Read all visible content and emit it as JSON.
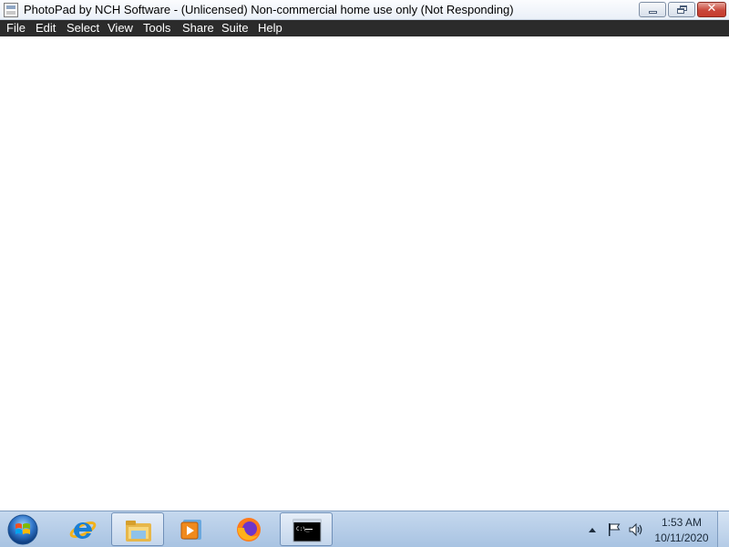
{
  "window": {
    "title": "PhotoPad by NCH Software - (Unlicensed) Non-commercial home use only (Not Responding)",
    "icon": "photopad-app-icon",
    "controls": {
      "minimize": "minimize-icon",
      "maximize": "restore-icon",
      "close": "✕"
    }
  },
  "menu": {
    "items": [
      {
        "label": "File"
      },
      {
        "label": "Edit"
      },
      {
        "label": "Select"
      },
      {
        "label": "View"
      },
      {
        "label": "Tools"
      },
      {
        "label": "Share"
      },
      {
        "label": "Suite"
      },
      {
        "label": "Help"
      }
    ]
  },
  "taskbar": {
    "start": "windows-start-icon",
    "apps": [
      {
        "name": "internet-explorer-icon",
        "active": false
      },
      {
        "name": "file-explorer-icon",
        "active": true
      },
      {
        "name": "media-player-icon",
        "active": false
      },
      {
        "name": "firefox-icon",
        "active": false
      },
      {
        "name": "command-prompt-icon",
        "active": true
      }
    ],
    "tray": {
      "icons": [
        "show-hidden-icons-arrow-icon",
        "action-center-flag-icon",
        "volume-icon"
      ],
      "time": "1:53 AM",
      "date": "10/11/2020"
    }
  },
  "colors": {
    "menubar_bg": "#2b2b2b",
    "menubar_text": "#ffffff",
    "content_bg": "#ffffff",
    "taskbar_bg": "#b8cfe8",
    "close_button": "#c63c2d"
  }
}
